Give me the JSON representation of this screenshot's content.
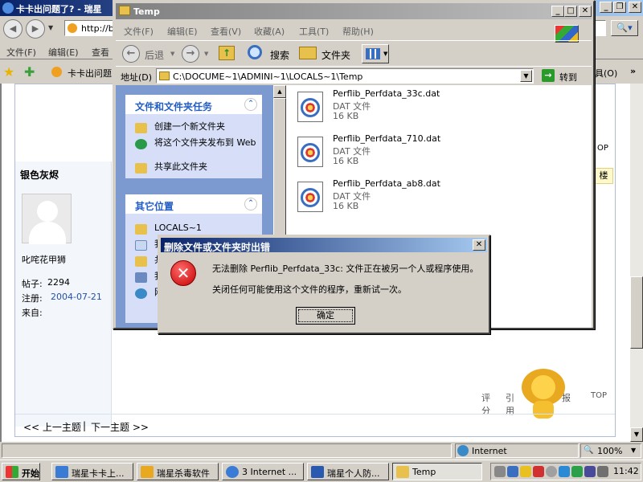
{
  "ie": {
    "title": "卡卡出问题了? - 瑞星",
    "address_prefix": "http://b",
    "menu": [
      "文件(F)",
      "编辑(E)",
      "查看"
    ],
    "fav_tab": "卡卡出问题",
    "right_menu": "具(O)",
    "top_link_1": "OP",
    "button_fragment": "楼",
    "forum": {
      "username": "银色灰烬",
      "nickname": "叱咤花甲狮",
      "posts_label": "帖子:",
      "posts_value": "2294",
      "reg_label": "注册:",
      "reg_value": "2004-07-21",
      "from_label": "来自:",
      "actions": [
        "评分",
        "引用",
        "报",
        "TOP"
      ],
      "nav_prev": "<< 上一主题",
      "nav_sep": "|",
      "nav_next": "下一主题 >>"
    },
    "status": {
      "zone": "Internet",
      "zoom": "100%"
    }
  },
  "explorer": {
    "title": "Temp",
    "menu": [
      "文件(F)",
      "编辑(E)",
      "查看(V)",
      "收藏(A)",
      "工具(T)",
      "帮助(H)"
    ],
    "toolbar": {
      "back": "后退",
      "search": "搜索",
      "folders": "文件夹"
    },
    "address_label": "地址(D)",
    "address_value": "C:\\DOCUME~1\\ADMINI~1\\LOCALS~1\\Temp",
    "go_label": "转到",
    "tasks_header": "文件和文件夹任务",
    "tasks": [
      "创建一个新文件夹",
      "将这个文件夹发布到 Web",
      "共享此文件夹"
    ],
    "places_header": "其它位置",
    "places": [
      "LOCALS~1",
      "我",
      "共",
      "我",
      "网"
    ],
    "files": [
      {
        "name": "Perflib_Perfdata_33c.dat",
        "type": "DAT 文件",
        "size": "16 KB"
      },
      {
        "name": "Perflib_Perfdata_710.dat",
        "type": "DAT 文件",
        "size": "16 KB"
      },
      {
        "name": "Perflib_Perfdata_ab8.dat",
        "type": "DAT 文件",
        "size": "16 KB"
      }
    ]
  },
  "dialog": {
    "title": "删除文件或文件夹时出错",
    "message1": "无法删除 Perflib_Perfdata_33c: 文件正在被另一个人或程序使用。",
    "message2": "关闭任何可能使用这个文件的程序，重新试一次。",
    "ok_label": "确定"
  },
  "taskbar": {
    "start": "开始",
    "tasks": [
      "瑞星卡卡上...",
      "瑞星杀毒软件",
      "3 Internet ...",
      "瑞星个人防...",
      "Temp"
    ],
    "clock": "11:42"
  },
  "colors": {
    "title_active": "#0a246a",
    "title_inactive": "#808080",
    "task_pane_link": "#215dc6",
    "error_red": "#c40000"
  }
}
